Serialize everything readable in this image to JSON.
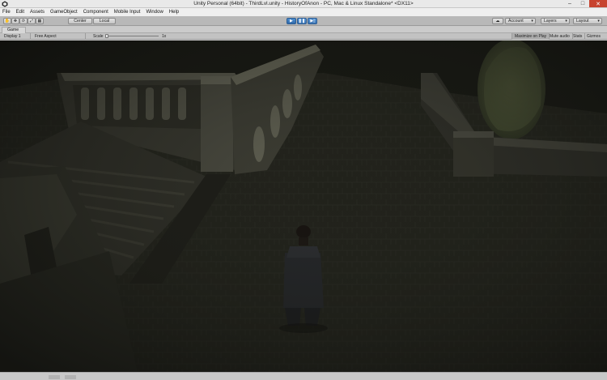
{
  "window": {
    "title": "Unity Personal (64bit) - ThirdLvl.unity - HistoryOfAnon - PC, Mac & Linux Standalone* <DX11>",
    "controls": {
      "minimize": "–",
      "maximize": "□",
      "close": "✕"
    }
  },
  "menu": [
    "File",
    "Edit",
    "Assets",
    "GameObject",
    "Component",
    "Mobile Input",
    "Window",
    "Help"
  ],
  "toolbar": {
    "pivot_label": "Center",
    "space_label": "Local",
    "account_label": "Account",
    "layers_label": "Layers",
    "layout_label": "Layout",
    "dropdown_glyph": "▾",
    "play_glyph": "▶",
    "pause_glyph": "❚❚",
    "step_glyph": "▶|",
    "cloud_glyph": "☁",
    "tool_glyphs": [
      "✋",
      "✥",
      "⟳",
      "⤢",
      "▦"
    ]
  },
  "game": {
    "tab_label": "Game",
    "display_label": "Display 1",
    "aspect_label": "Free Aspect",
    "scale_label": "Scale",
    "scale_value": "1x",
    "maximize_label": "Maximize on Play",
    "mute_label": "Mute audio",
    "stats_label": "Stats",
    "gizmos_label": "Gizmos"
  },
  "icons": {
    "unity_logo": "unity-logo-icon",
    "play": "play-icon",
    "pause": "pause-icon",
    "step": "step-icon",
    "cloud": "cloud-icon"
  },
  "colors": {
    "play_active": "#3a78bd",
    "scene_base": "#1b1c17",
    "close_button": "#c7432f"
  }
}
